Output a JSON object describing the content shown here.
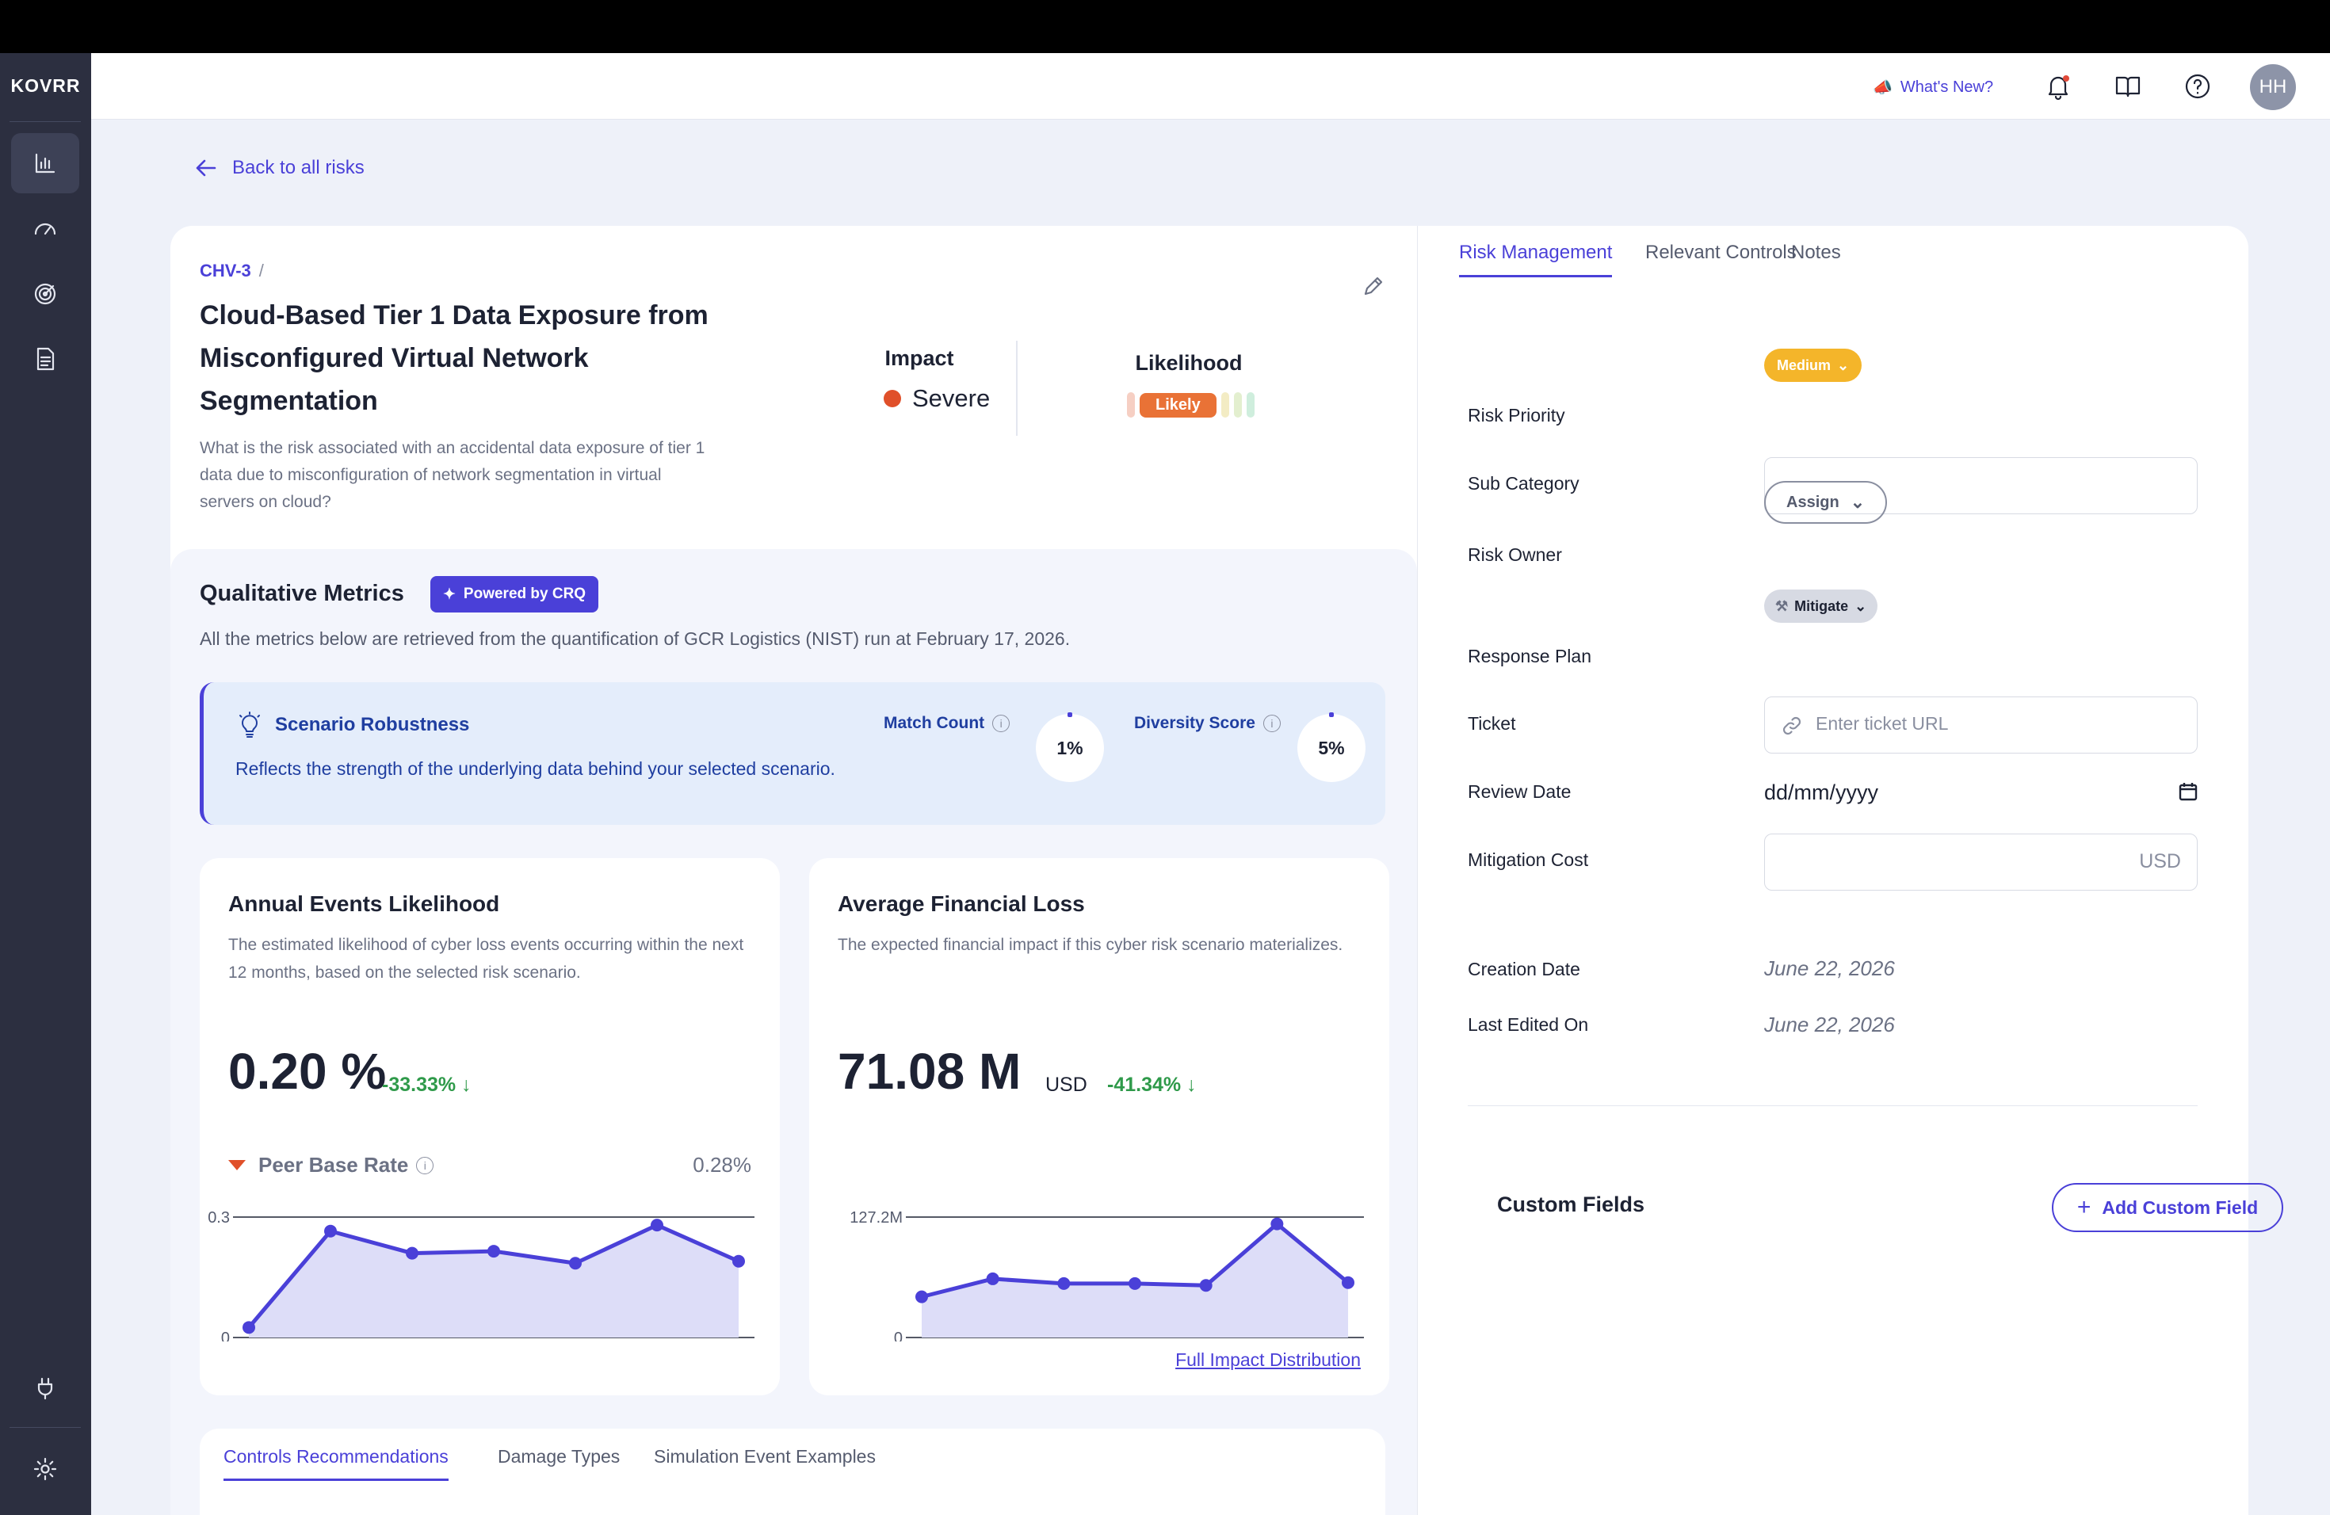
{
  "app": {
    "logo": "KOVRR"
  },
  "header": {
    "whats_new": "What's New?",
    "whats_new_icon": "megaphone-icon",
    "avatar_initials": "HH",
    "icons": [
      "bell-icon",
      "book-icon",
      "help-icon"
    ]
  },
  "sidebar": {
    "items": [
      {
        "icon": "bar-chart-icon",
        "active": true
      },
      {
        "icon": "gauge-icon",
        "active": false
      },
      {
        "icon": "target-icon",
        "active": false
      },
      {
        "icon": "document-icon",
        "active": false
      },
      {
        "icon": "plug-icon",
        "active": false
      },
      {
        "icon": "settings-icon",
        "active": false
      }
    ]
  },
  "nav": {
    "back_label": "Back to all risks"
  },
  "risk": {
    "id": "CHV-3",
    "separator": "/",
    "title": "Cloud-Based Tier 1 Data Exposure from Misconfigured Virtual Network Segmentation",
    "description": "What is the risk associated with an accidental data exposure of tier 1 data due to misconfiguration of network segmentation in virtual servers on cloud?",
    "impact_label": "Impact",
    "impact_value": "Severe",
    "likelihood_label": "Likelihood",
    "likelihood_value": "Likely"
  },
  "qualitative": {
    "title": "Qualitative Metrics",
    "badge": "Powered by CRQ",
    "subtitle": "All the metrics below are retrieved from the quantification of GCR Logistics (NIST) run at February 17, 2026.",
    "robustness": {
      "title": "Scenario Robustness",
      "description": "Reflects the strength of the underlying data behind your selected scenario.",
      "match_count_label": "Match Count",
      "match_count_value": "1%",
      "diversity_score_label": "Diversity Score",
      "diversity_score_value": "5%"
    }
  },
  "annual": {
    "title": "Annual Events Likelihood",
    "description": "The estimated likelihood of cyber loss events occurring within the next 12 months, based on the selected risk scenario.",
    "value": "0.20 %",
    "change": "-33.33%",
    "change_arrow": "↓",
    "peer_label": "Peer Base Rate",
    "peer_value": "0.28%"
  },
  "financial": {
    "title": "Average Financial Loss",
    "description": "The expected financial impact if this cyber risk scenario materializes.",
    "value": "71.08 M",
    "unit": "USD",
    "change": "-41.34%",
    "change_arrow": "↓",
    "link": "Full Impact Distribution"
  },
  "chart_data": [
    {
      "type": "area",
      "x": [
        1,
        2,
        3,
        4,
        5,
        6,
        7
      ],
      "values": [
        0.025,
        0.265,
        0.21,
        0.215,
        0.185,
        0.28,
        0.19
      ],
      "ylim": [
        0,
        0.3
      ],
      "yticks": [
        "0.3",
        "0"
      ],
      "color": "#4a40d8",
      "fill": "#ddddf8"
    },
    {
      "type": "area",
      "x": [
        1,
        2,
        3,
        4,
        5,
        6,
        7
      ],
      "values": [
        43,
        62,
        57,
        57,
        55,
        120,
        58
      ],
      "ylim": [
        0,
        127.2
      ],
      "yticks": [
        "127.2M",
        "0"
      ],
      "color": "#4a40d8",
      "fill": "#ddddf8"
    }
  ],
  "bottom_tabs": [
    "Controls Recommendations",
    "Damage Types",
    "Simulation Event Examples"
  ],
  "right_tabs": [
    "Risk Management",
    "Relevant Controls",
    "Notes"
  ],
  "form": {
    "risk_priority_label": "Risk Priority",
    "risk_priority_value": "Medium",
    "sub_category_label": "Sub Category",
    "sub_category_value": "",
    "risk_owner_label": "Risk Owner",
    "risk_owner_button": "Assign",
    "response_plan_label": "Response Plan",
    "response_plan_value": "Mitigate",
    "ticket_label": "Ticket",
    "ticket_placeholder": "Enter ticket URL",
    "review_date_label": "Review Date",
    "review_date_placeholder": "dd/mm/yyyy",
    "mitigation_cost_label": "Mitigation Cost",
    "mitigation_cost_currency": "USD",
    "creation_date_label": "Creation Date",
    "creation_date_value": "June 22, 2026",
    "last_edited_label": "Last Edited On",
    "last_edited_value": "June 22, 2026"
  },
  "custom_fields": {
    "title": "Custom Fields",
    "button": "Add Custom Field"
  }
}
